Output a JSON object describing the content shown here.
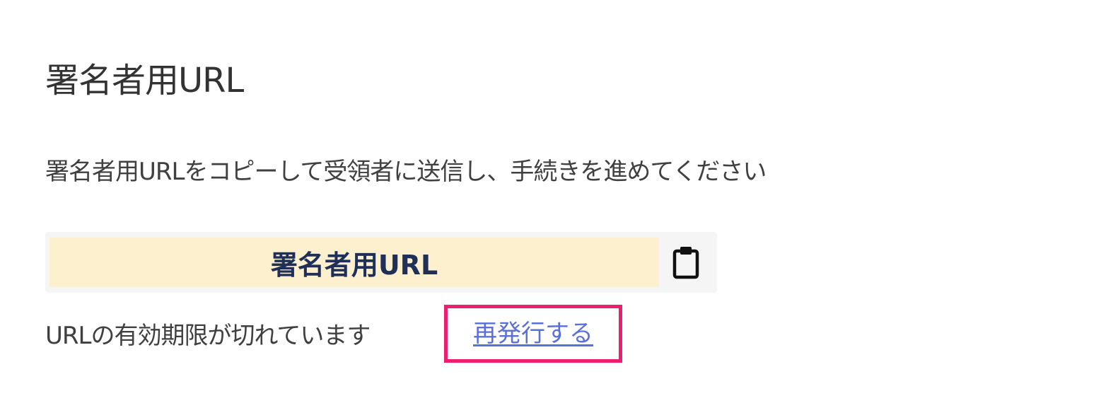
{
  "header": {
    "title": "署名者用URL"
  },
  "main": {
    "description": "署名者用URLをコピーして受領者に送信し、手続きを進めてください",
    "url_field": {
      "value": "署名者用URL",
      "copy_icon": "clipboard-icon"
    },
    "expiry": {
      "message": "URLの有効期限が切れています",
      "reissue_label": "再発行する",
      "highlight_color": "#ec1f6e",
      "link_color": "#5a6fd8"
    }
  },
  "colors": {
    "field_background": "#fdf0cf",
    "field_text": "#1f2f57",
    "box_background": "#f5f5f5"
  }
}
